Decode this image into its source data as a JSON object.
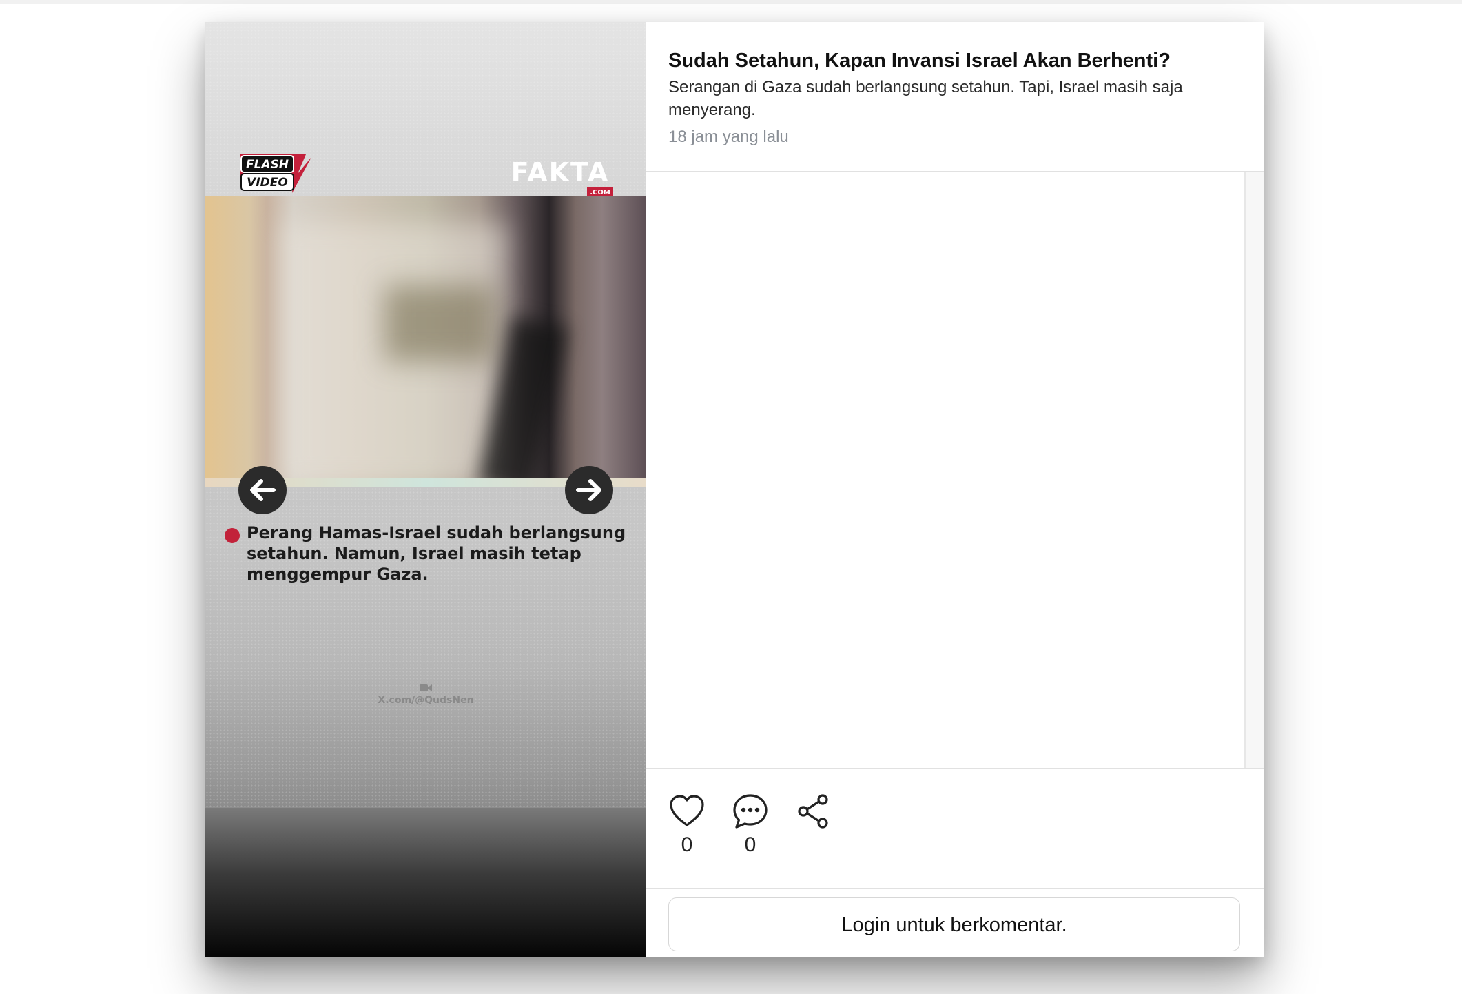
{
  "video": {
    "flash_logo_line1": "FLASH",
    "flash_logo_line2": "VIDEO",
    "brand_logo": "FAKTA",
    "brand_logo_suffix": ".COM",
    "caption": "Perang Hamas-Israel sudah berlangsung setahun. Namun, Israel masih tetap menggempur Gaza.",
    "credit": "X.com/@QudsNen",
    "prev_icon": "arrow-left-icon",
    "next_icon": "arrow-right-icon",
    "accent_color": "#c2223a"
  },
  "post": {
    "title": "Sudah Setahun, Kapan Invansi Israel Akan Berhenti?",
    "description": "Serangan di Gaza sudah berlangsung setahun. Tapi, Israel masih saja menyerang.",
    "time": "18 jam yang lalu"
  },
  "actions": {
    "like_icon": "heart-icon",
    "like_count": "0",
    "comment_icon": "comment-bubble-icon",
    "comment_count": "0",
    "share_icon": "share-icon"
  },
  "login": {
    "label": "Login untuk berkomentar."
  }
}
